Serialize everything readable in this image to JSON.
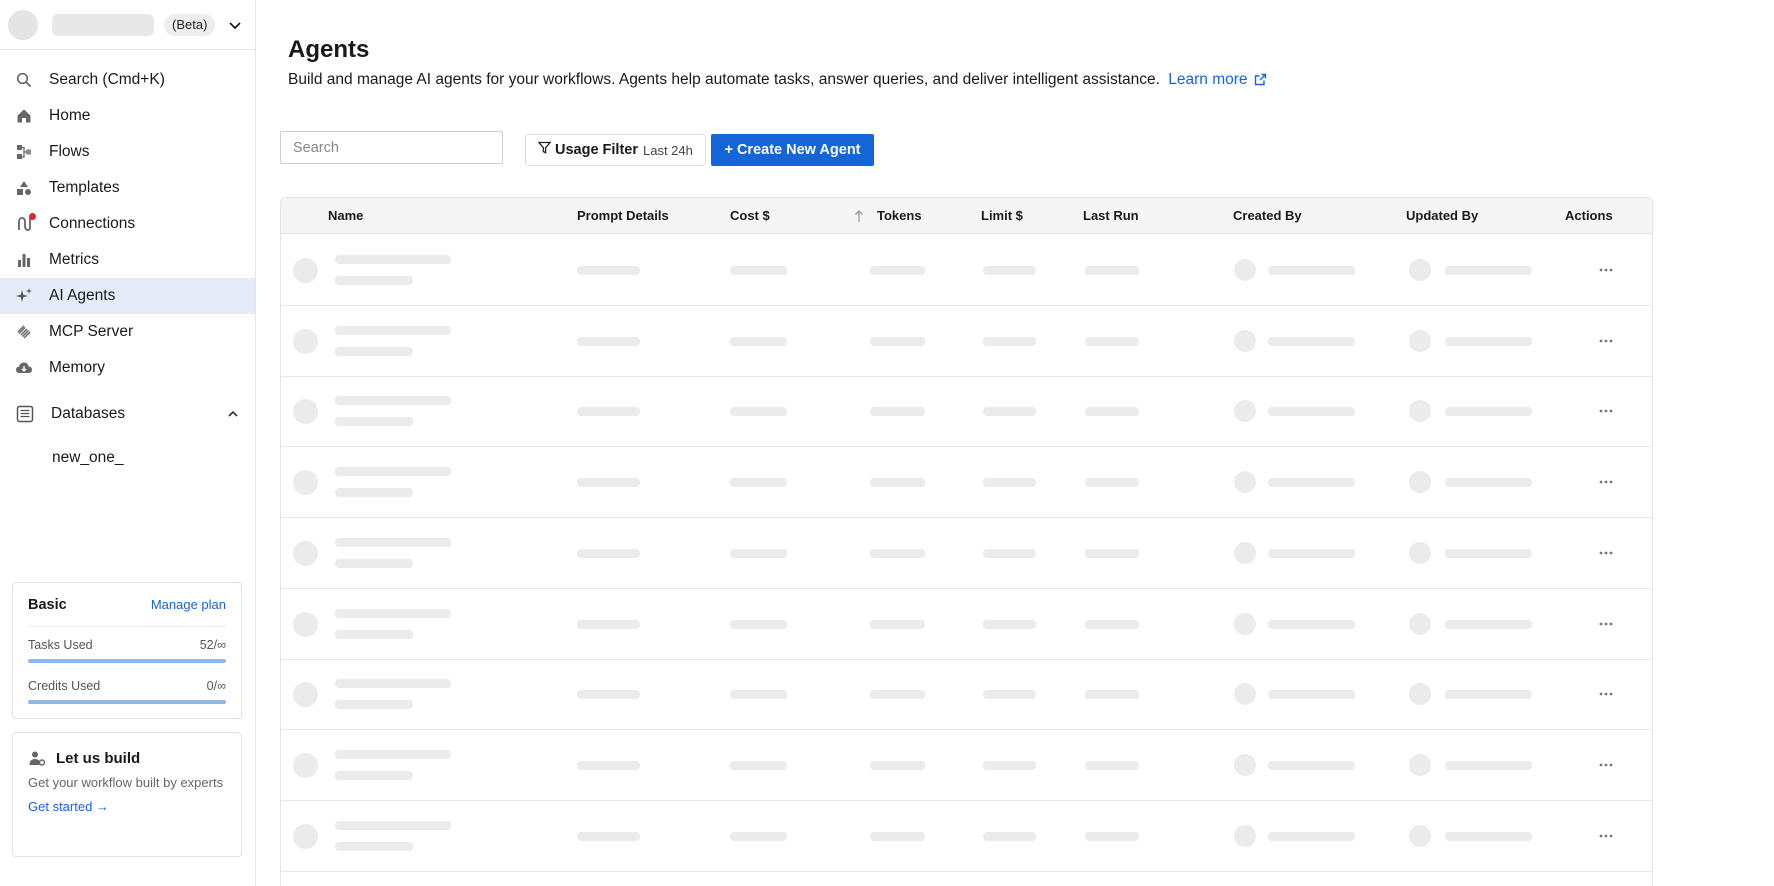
{
  "workspace": {
    "badge": "(Beta)"
  },
  "nav": [
    {
      "id": "search",
      "label": "Search (Cmd+K)",
      "icon": "search-icon"
    },
    {
      "id": "home",
      "label": "Home",
      "icon": "home-icon"
    },
    {
      "id": "flows",
      "label": "Flows",
      "icon": "flows-icon"
    },
    {
      "id": "templates",
      "label": "Templates",
      "icon": "templates-icon"
    },
    {
      "id": "connections",
      "label": "Connections",
      "icon": "connections-icon",
      "notification": true
    },
    {
      "id": "metrics",
      "label": "Metrics",
      "icon": "metrics-icon"
    },
    {
      "id": "ai-agents",
      "label": "AI Agents",
      "icon": "sparkle-icon",
      "active": true
    },
    {
      "id": "mcp-server",
      "label": "MCP Server",
      "icon": "mcp-icon"
    },
    {
      "id": "memory",
      "label": "Memory",
      "icon": "cloud-icon"
    }
  ],
  "databases": {
    "label": "Databases",
    "expanded": true,
    "items": [
      "new_one_"
    ]
  },
  "plan": {
    "name": "Basic",
    "manage_label": "Manage plan",
    "tasks_label": "Tasks Used",
    "tasks_value": "52/∞",
    "credits_label": "Credits Used",
    "credits_value": "0/∞"
  },
  "build": {
    "title": "Let us build",
    "description": "Get your workflow built by experts",
    "cta": "Get started →"
  },
  "page": {
    "title": "Agents",
    "description": "Build and manage AI agents for your workflows. Agents help automate tasks, answer queries, and deliver intelligent assistance.",
    "learn_more": "Learn more"
  },
  "toolbar": {
    "search_placeholder": "Search",
    "filter_label": "Usage Filter",
    "filter_value": "Last 24h",
    "create_label": "+ Create New Agent"
  },
  "table": {
    "columns": [
      "Name",
      "Prompt Details",
      "Cost $",
      "Tokens",
      "Limit $",
      "Last Run",
      "Created By",
      "Updated By",
      "Actions"
    ],
    "sorted_column": "Tokens",
    "sort_direction": "ascending",
    "loading": true,
    "placeholder_rows": 9
  },
  "colors": {
    "accent": "#1466d8",
    "active_nav": "#e4ecfa",
    "notification": "#e8202e"
  }
}
